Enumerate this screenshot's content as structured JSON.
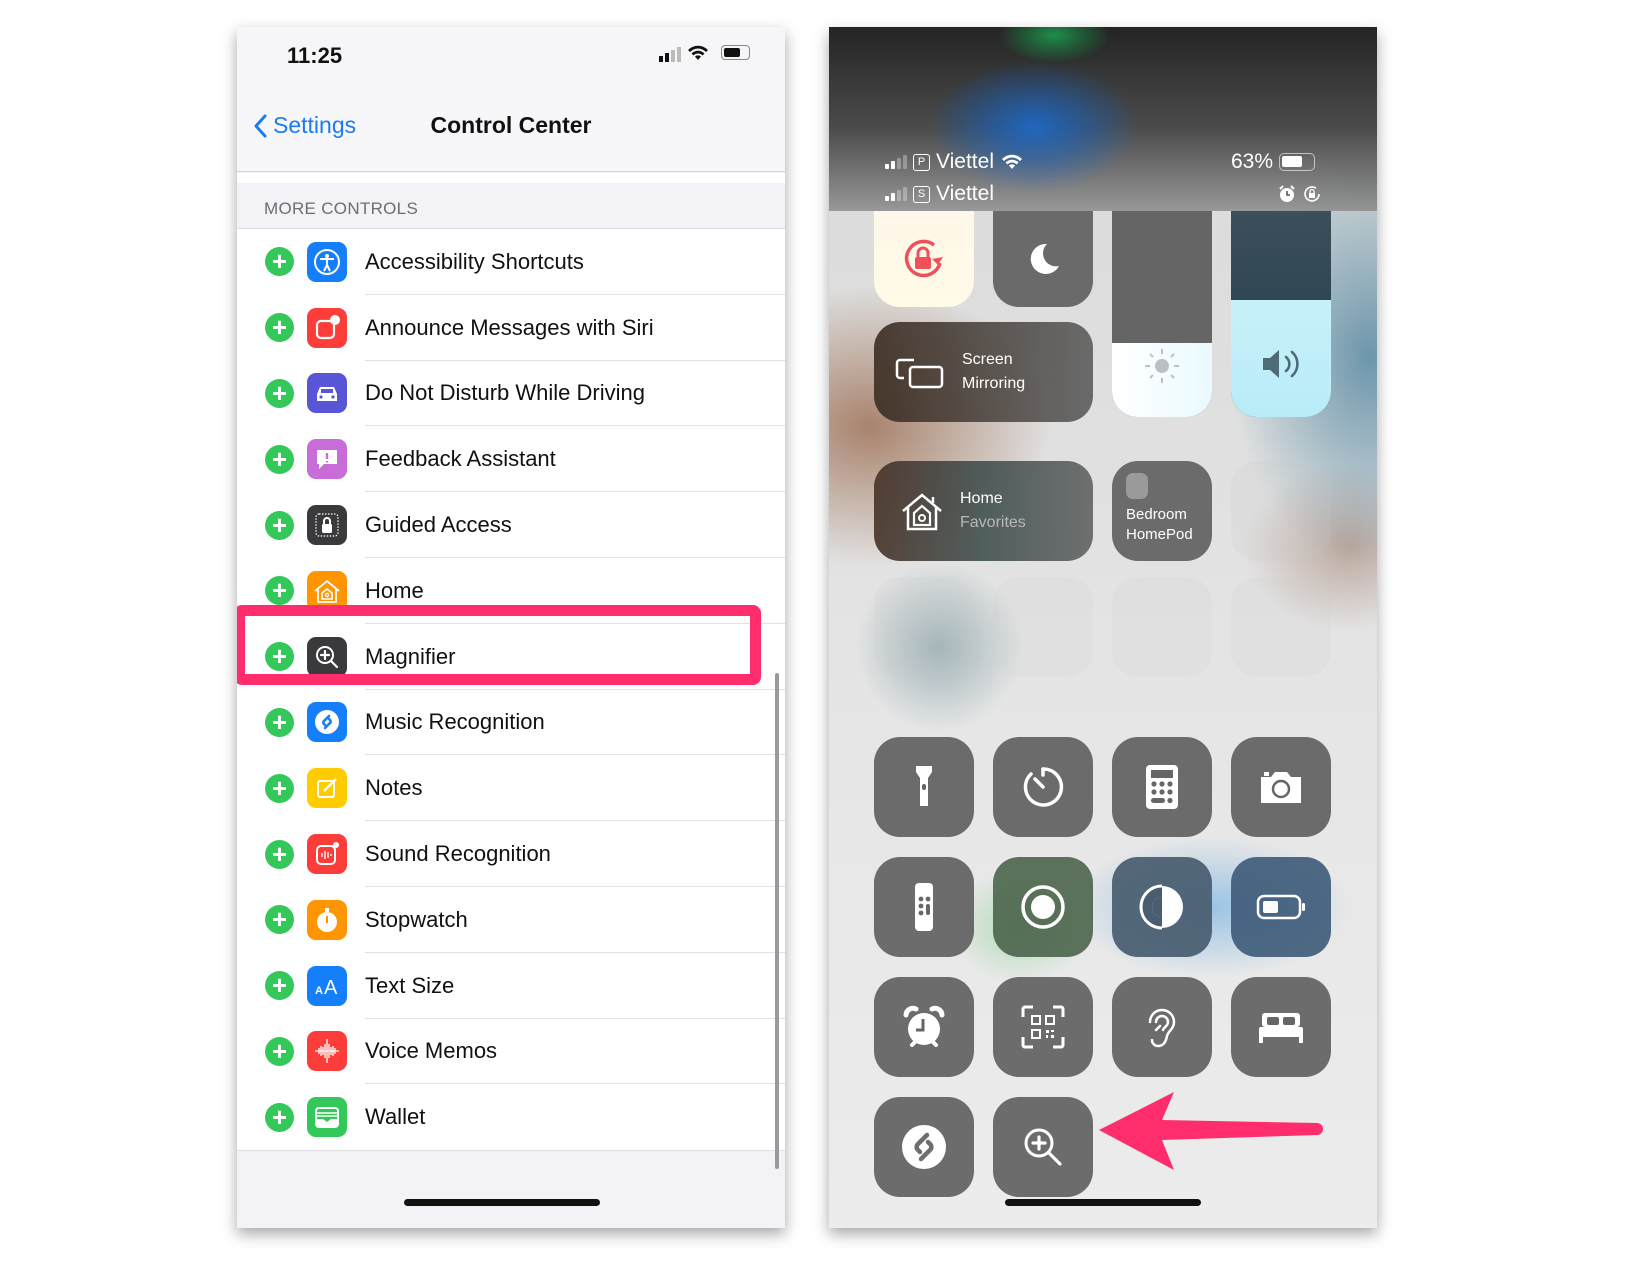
{
  "left_screen": {
    "status_bar": {
      "time": "11:25",
      "icons": [
        "signal-icon",
        "wifi-icon",
        "battery-icon"
      ]
    },
    "nav": {
      "back_label": "Settings",
      "title": "Control Center"
    },
    "section_header": "MORE CONTROLS",
    "items": [
      {
        "label": "Accessibility Shortcuts",
        "icon": "accessibility-icon",
        "color": "#147efb"
      },
      {
        "label": "Announce Messages with Siri",
        "icon": "announce-messages-icon",
        "color": "#fc3d39"
      },
      {
        "label": "Do Not Disturb While Driving",
        "icon": "car-icon",
        "color": "#5856d6"
      },
      {
        "label": "Feedback Assistant",
        "icon": "feedback-icon",
        "color": "#c86dd7"
      },
      {
        "label": "Guided Access",
        "icon": "lock-icon",
        "color": "#3a3a3c"
      },
      {
        "label": "Home",
        "icon": "home-icon",
        "color": "#ff9500"
      },
      {
        "label": "Magnifier",
        "icon": "magnifier-icon",
        "color": "#3a3a3c",
        "highlighted": true
      },
      {
        "label": "Music Recognition",
        "icon": "shazam-icon",
        "color": "#147efb"
      },
      {
        "label": "Notes",
        "icon": "notes-icon",
        "color": "#ffcc00"
      },
      {
        "label": "Sound Recognition",
        "icon": "sound-recognition-icon",
        "color": "#fc3d39"
      },
      {
        "label": "Stopwatch",
        "icon": "stopwatch-icon",
        "color": "#ff9500"
      },
      {
        "label": "Text Size",
        "icon": "text-size-icon",
        "color": "#147efb"
      },
      {
        "label": "Voice Memos",
        "icon": "voice-memos-icon",
        "color": "#fc3d39"
      },
      {
        "label": "Wallet",
        "icon": "wallet-icon",
        "color": "#34c759"
      }
    ],
    "add_button_glyph": "+",
    "highlight_color": "#ff2d6b"
  },
  "right_screen": {
    "status": {
      "carrier1": "Viettel",
      "sim1_badge": "P",
      "carrier2": "Viettel",
      "sim2_badge": "S",
      "battery_percent": "63%"
    },
    "brightness_level": 0.36,
    "volume_level": 0.57,
    "screen_mirroring": {
      "line1": "Screen",
      "line2": "Mirroring"
    },
    "home": {
      "title": "Home",
      "subtitle": "Favorites"
    },
    "homepod": {
      "line1": "Bedroom",
      "line2": "HomePod"
    },
    "controls": [
      "flashlight-icon",
      "timer-icon",
      "calculator-icon",
      "camera-icon",
      "apple-tv-remote-icon",
      "screen-record-icon",
      "dark-mode-icon",
      "low-power-icon",
      "alarm-icon",
      "qr-code-icon",
      "hearing-icon",
      "sleep-icon",
      "shazam-icon",
      "magnifier-icon"
    ],
    "arrow_color": "#ff2d6b"
  }
}
